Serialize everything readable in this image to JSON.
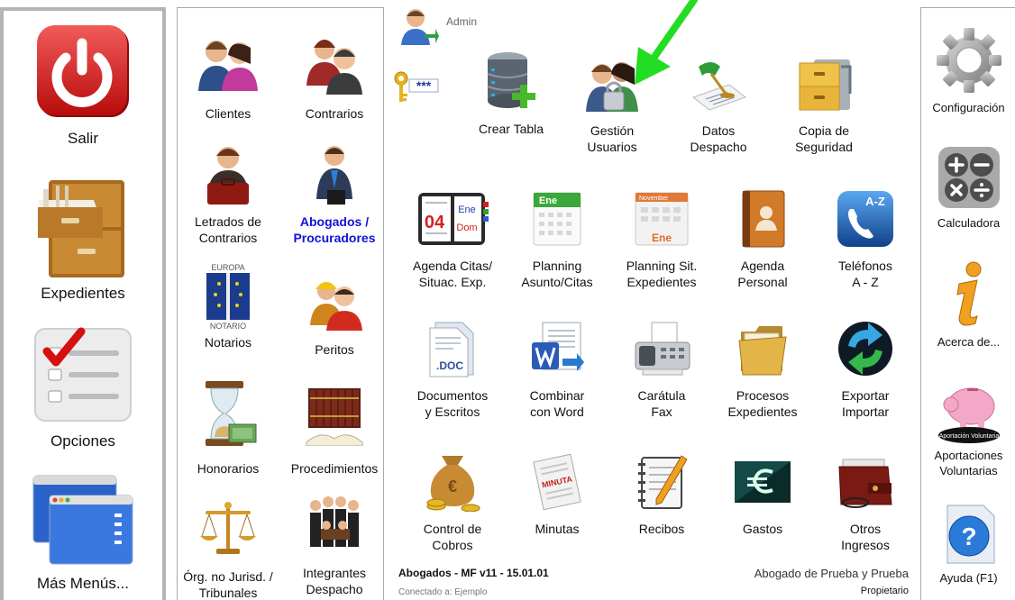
{
  "left_menu": {
    "salir": "Salir",
    "expedientes": "Expedientes",
    "opciones": "Opciones",
    "mas_menus": "Más Menús..."
  },
  "mid_menu": {
    "clientes": "Clientes",
    "contrarios": "Contrarios",
    "letrados": "Letrados de Contrarios",
    "abogados": "Abogados / Procuradores",
    "notarios": "Notarios",
    "europa_text": "EUROPA",
    "notario_text": "NOTARIO",
    "peritos": "Peritos",
    "honorarios": "Honorarios",
    "procedimientos": "Procedimientos",
    "org_no_jurisd": "Órg. no Jurisd. / Tribunales",
    "integrantes": "Integrantes Despacho"
  },
  "user": {
    "name": "Admin",
    "password_mask": "***"
  },
  "center_menu": {
    "crear_tabla": "Crear Tabla",
    "gestion_usuarios": "Gestión\nUsuarios",
    "datos_despacho": "Datos\nDespacho",
    "copia_seguridad": "Copia de\nSeguridad",
    "agenda_citas": "Agenda Citas/\nSituac. Exp.",
    "planning_asunto": "Planning\nAsunto/Citas",
    "planning_sit": "Planning Sit.\nExpedientes",
    "agenda_personal": "Agenda\nPersonal",
    "telefonos": "Teléfonos\nA - Z",
    "documentos": "Documentos\ny Escritos",
    "combinar_word": "Combinar\ncon Word",
    "caratula_fax": "Carátula\nFax",
    "procesos": "Procesos\nExpedientes",
    "exportar": "Exportar\nImportar",
    "control_cobros": "Control de\nCobros",
    "minutas": "Minutas",
    "recibos": "Recibos",
    "gastos": "Gastos",
    "otros_ingresos": "Otros\nIngresos"
  },
  "icon_text": {
    "cal_day": "04",
    "cal_month": "Ene",
    "cal_weekday": "Dom",
    "planning_month": "Ene",
    "planning_sit_header": "November",
    "planning_sit_month": "Ene",
    "az": "A-Z",
    "doc_ext": ".DOC",
    "minuta_stamp": "MINUTA"
  },
  "right_menu": {
    "configuracion": "Configuración",
    "calculadora": "Calculadora",
    "acerca": "Acerca de...",
    "aportaciones": "Aportaciones\nVoluntarias",
    "aportacion_badge": "Aportación Voluntaria",
    "ayuda": "Ayuda  (F1)"
  },
  "footer": {
    "app_version": "Abogados - MF v11 - 15.01.01",
    "connected": "Conectado a: Ejemplo",
    "user_full": "Abogado de Prueba y Prueba",
    "role": "Propietario"
  },
  "colors": {
    "panel_border": "#b4b4b4",
    "abogados_link": "#1212d8",
    "arrow": "#22dd22"
  }
}
